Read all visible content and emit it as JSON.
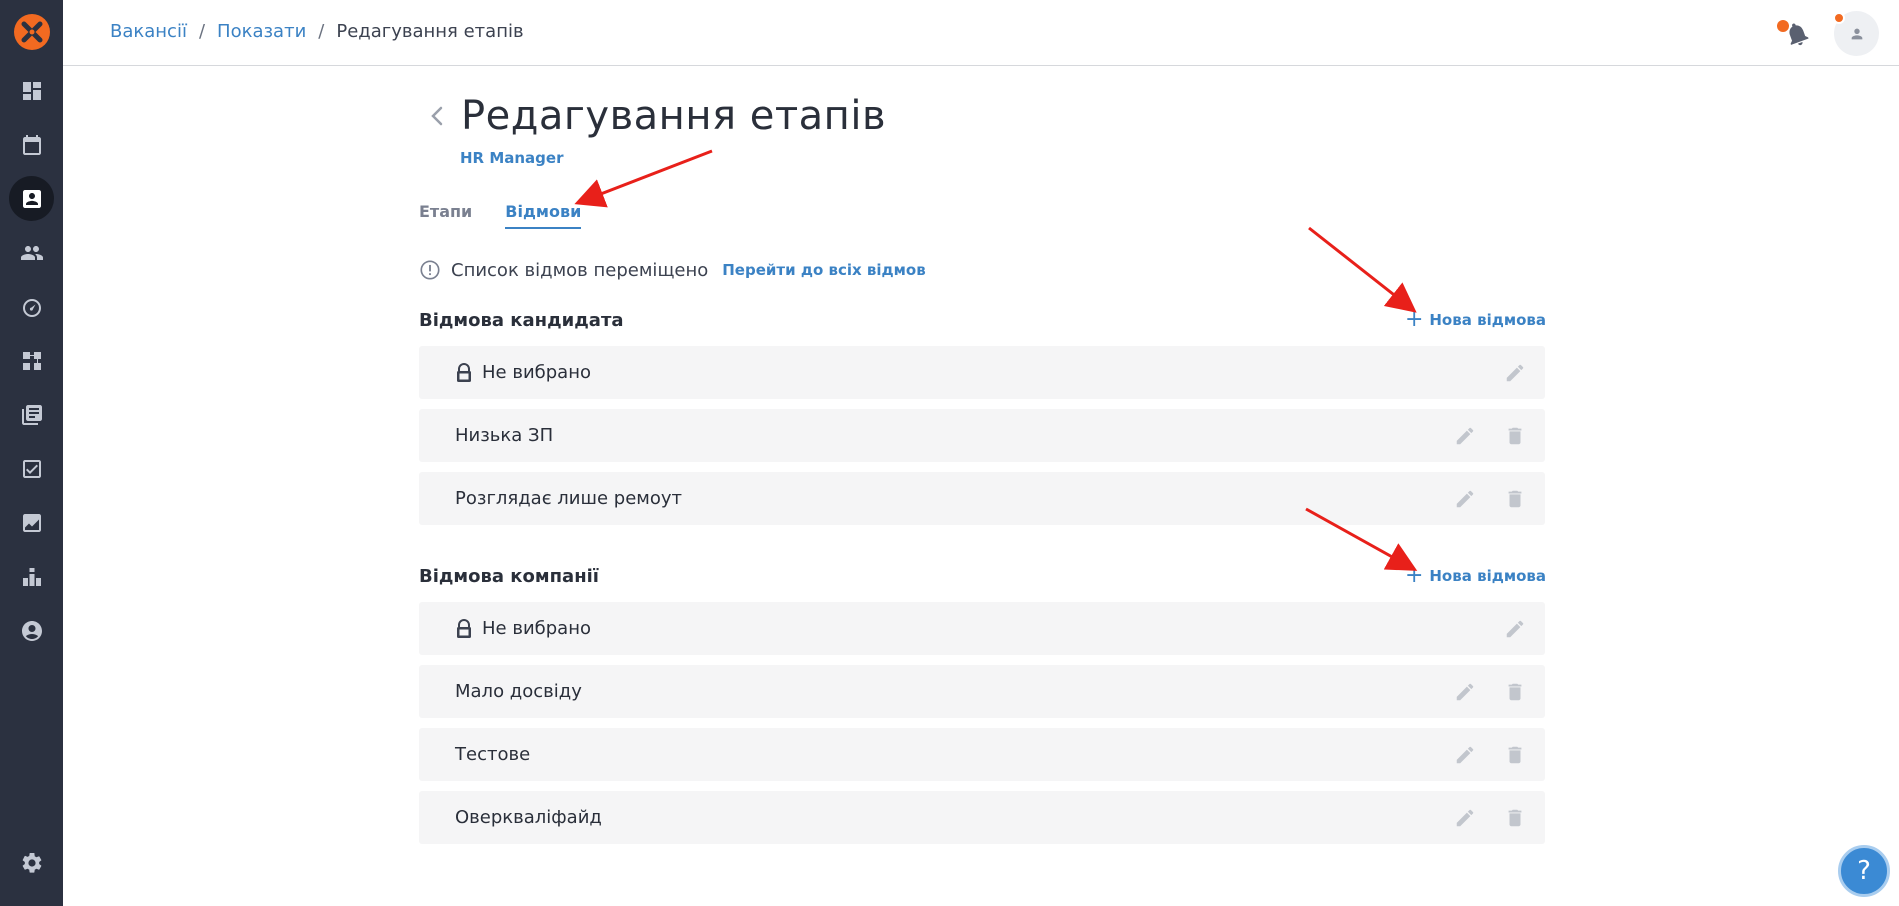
{
  "sidebar": {
    "logo": "brand-logo",
    "items": [
      {
        "name": "dashboard-icon",
        "active": false
      },
      {
        "name": "calendar-icon",
        "active": false
      },
      {
        "name": "vacancies-icon",
        "active": true
      },
      {
        "name": "candidates-icon",
        "active": false
      },
      {
        "name": "speedometer-icon",
        "active": false
      },
      {
        "name": "workflow-icon",
        "active": false
      },
      {
        "name": "library-icon",
        "active": false
      },
      {
        "name": "tasks-icon",
        "active": false
      },
      {
        "name": "analytics-icon",
        "active": false
      },
      {
        "name": "integrations-icon",
        "active": false
      },
      {
        "name": "profile-icon",
        "active": false
      }
    ],
    "settings": "gear-icon"
  },
  "header": {
    "breadcrumb": [
      "Вакансії",
      "Показати",
      "Редагування етапів"
    ],
    "separator": "/"
  },
  "page": {
    "title": "Редагування етапів",
    "subtitle": "HR Manager",
    "tabs": [
      {
        "label": "Етапи",
        "active": false
      },
      {
        "label": "Відмови",
        "active": true
      }
    ],
    "notice": {
      "text": "Список відмов переміщено",
      "link": "Перейти до всіх відмов"
    }
  },
  "sections": [
    {
      "title": "Відмова кандидата",
      "add_label": "Нова відмова",
      "rows": [
        {
          "label": "Не вибрано",
          "locked": true
        },
        {
          "label": "Низька ЗП",
          "locked": false
        },
        {
          "label": "Розглядає лише ремоут",
          "locked": false
        }
      ]
    },
    {
      "title": "Відмова компанії",
      "add_label": "Нова відмова",
      "rows": [
        {
          "label": "Не вибрано",
          "locked": true
        },
        {
          "label": "Мало досвіду",
          "locked": false
        },
        {
          "label": "Тестове",
          "locked": false
        },
        {
          "label": "Оверкваліфайд",
          "locked": false
        }
      ]
    }
  ],
  "help": "?",
  "colors": {
    "sidebar": "#2b3140",
    "accent": "#3b82c4",
    "brand": "#f26a21",
    "row_bg": "#f5f5f6",
    "annotation": "#e8201a"
  }
}
